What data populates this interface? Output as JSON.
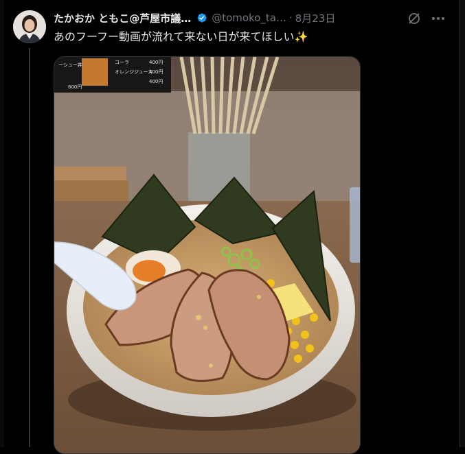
{
  "tweet": {
    "author": {
      "display_name": "たかおか ともこ@芦屋市議…",
      "handle": "@tomoko_ta…",
      "verified": true
    },
    "separator": "·",
    "date": "8月23日",
    "text": "あのフーフー動画が流れて来ない日が来てほしい✨"
  },
  "icons": {
    "verified": "verified-badge-icon",
    "grok": "grok-icon",
    "more": "more-icon"
  },
  "media": {
    "type": "photo",
    "menu_board": {
      "items_left": [
        "ーシュー丼"
      ],
      "items_right": [
        "コーラ",
        "オレンジジュース"
      ],
      "prices": [
        "400円",
        "400円",
        "400円",
        "600円"
      ]
    }
  },
  "colors": {
    "background": "#000000",
    "text": "#e7e9ea",
    "muted": "#71767b",
    "verified": "#1d9bf0",
    "border": "#2f3336"
  }
}
